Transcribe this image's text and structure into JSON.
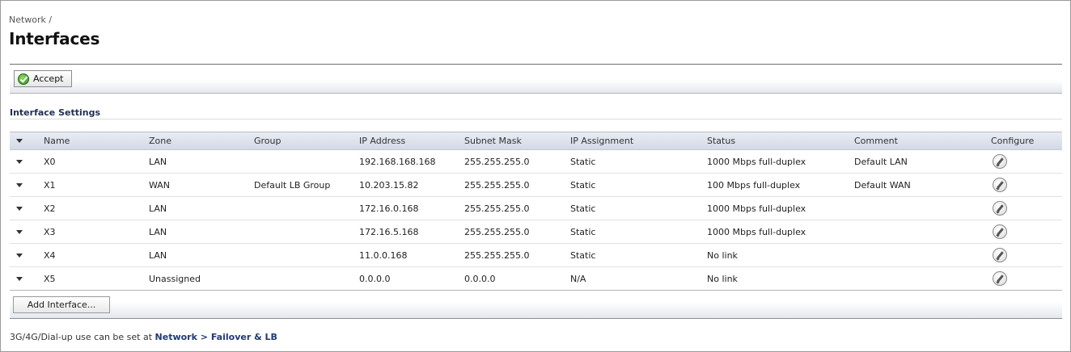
{
  "breadcrumb": "Network /",
  "title": "Interfaces",
  "toolbar": {
    "accept_label": "Accept"
  },
  "section": {
    "heading": "Interface Settings"
  },
  "table": {
    "columns": [
      "Name",
      "Zone",
      "Group",
      "IP Address",
      "Subnet Mask",
      "IP Assignment",
      "Status",
      "Comment",
      "Configure"
    ],
    "rows": [
      {
        "name": "X0",
        "zone": "LAN",
        "group": "",
        "ip": "192.168.168.168",
        "mask": "255.255.255.0",
        "assign": "Static",
        "status": "1000 Mbps full-duplex",
        "comment": "Default LAN"
      },
      {
        "name": "X1",
        "zone": "WAN",
        "group": "Default LB Group",
        "ip": "10.203.15.82",
        "mask": "255.255.255.0",
        "assign": "Static",
        "status": "100 Mbps full-duplex",
        "comment": "Default WAN"
      },
      {
        "name": "X2",
        "zone": "LAN",
        "group": "",
        "ip": "172.16.0.168",
        "mask": "255.255.255.0",
        "assign": "Static",
        "status": "1000 Mbps full-duplex",
        "comment": ""
      },
      {
        "name": "X3",
        "zone": "LAN",
        "group": "",
        "ip": "172.16.5.168",
        "mask": "255.255.255.0",
        "assign": "Static",
        "status": "1000 Mbps full-duplex",
        "comment": ""
      },
      {
        "name": "X4",
        "zone": "LAN",
        "group": "",
        "ip": "11.0.0.168",
        "mask": "255.255.255.0",
        "assign": "Static",
        "status": "No link",
        "comment": ""
      },
      {
        "name": "X5",
        "zone": "Unassigned",
        "group": "",
        "ip": "0.0.0.0",
        "mask": "0.0.0.0",
        "assign": "N/A",
        "status": "No link",
        "comment": ""
      }
    ]
  },
  "footer": {
    "add_label": "Add Interface..."
  },
  "note": {
    "text": "3G/4G/Dial-up use can be set at ",
    "link_network": "Network",
    "separator": " > ",
    "link_failover": "Failover & LB"
  }
}
